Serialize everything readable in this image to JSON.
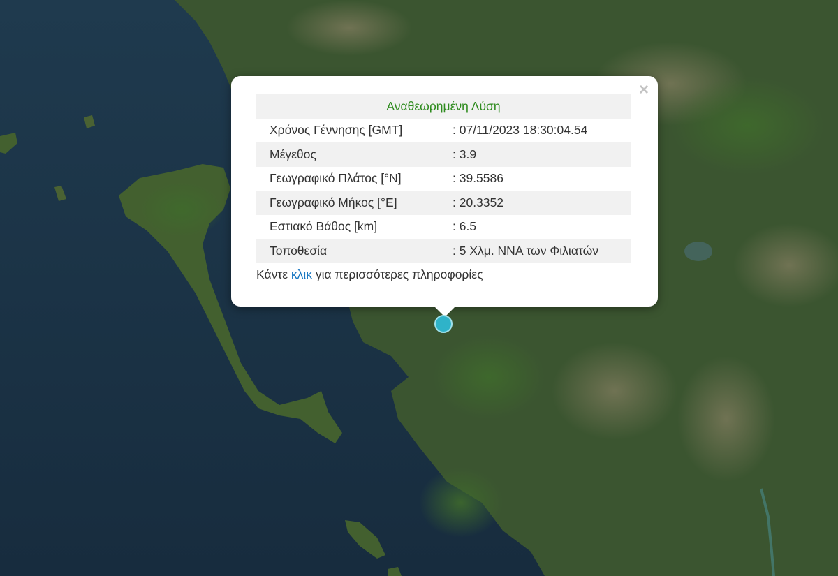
{
  "map": {
    "colors": {
      "sea": "#1b3346",
      "land_dark": "#2f4a24",
      "land_light": "#6e7a4a",
      "marker": "#2fb3c9"
    }
  },
  "popup": {
    "header": "Αναθεωρημένη Λύση",
    "close_symbol": "×",
    "rows": [
      {
        "label": "Χρόνος Γέννησης [GMT]",
        "value": ": 07/11/2023 18:30:04.54"
      },
      {
        "label": "Μέγεθος",
        "value": ": 3.9"
      },
      {
        "label": "Γεωγραφικό Πλάτος [°N]",
        "value": ": 39.5586"
      },
      {
        "label": "Γεωγραφικό Μήκος [°E]",
        "value": ": 20.3352"
      },
      {
        "label": "Εστιακό Βάθος [km]",
        "value": ": 6.5"
      },
      {
        "label": "Τοποθεσία",
        "value": ": 5 Χλμ. ΝΝΑ των Φιλιατών"
      }
    ],
    "more_prefix": "Κάντε ",
    "more_link": "κλικ",
    "more_suffix": " για περισσότερες πληροφορίες"
  }
}
